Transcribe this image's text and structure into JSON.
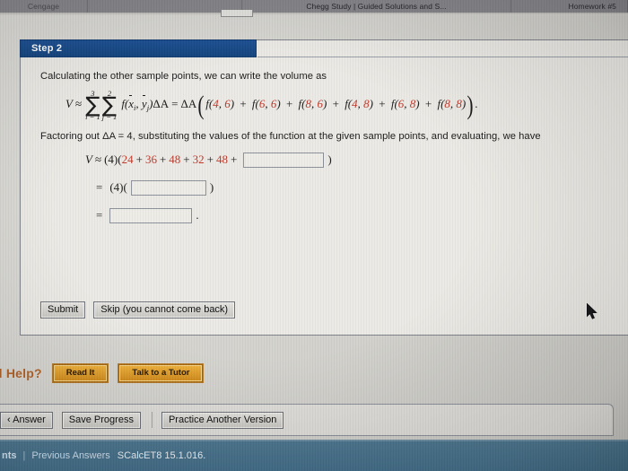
{
  "browser": {
    "tabs": [
      {
        "title": "Cengage"
      },
      {
        "title": ""
      },
      {
        "title": "Chegg Study | Guided Solutions and S..."
      },
      {
        "title": "Homework #5"
      }
    ]
  },
  "step": {
    "header_label": "Step 2",
    "intro_text": "Calculating the other sample points, we can write the volume as",
    "factoring_text": "Factoring out ΔA = 4, substituting the values of the function at the given sample points, and evaluating, we have"
  },
  "equation1": {
    "lhs_var": "V",
    "approx": "≈",
    "sum1": {
      "upper": "3",
      "lower": "i = 1"
    },
    "sum2": {
      "upper": "2",
      "lower": "j = 1"
    },
    "term": "f(x̅i, y̅j)ΔA",
    "equals": "=",
    "delta_a": "ΔA",
    "f_terms": [
      {
        "x": "4",
        "y": "6"
      },
      {
        "x": "6",
        "y": "6"
      },
      {
        "x": "8",
        "y": "6"
      },
      {
        "x": "4",
        "y": "8"
      },
      {
        "x": "6",
        "y": "8"
      },
      {
        "x": "8",
        "y": "8"
      }
    ],
    "trailing_period": "."
  },
  "equation2": {
    "lhs_var": "V",
    "approx": "≈",
    "factor": "(4)(",
    "values": [
      "24",
      "36",
      "48",
      "32",
      "48"
    ],
    "plus": "+",
    "input_value": "",
    "close_paren": ")"
  },
  "equation3": {
    "equals": "=",
    "factor": "(4)(",
    "input_value": "",
    "close_paren": ")"
  },
  "equation4": {
    "equals": "=",
    "input_value": "",
    "trailing_period": "."
  },
  "actions": {
    "submit_label": "Submit",
    "skip_label": "Skip (you cannot come back)"
  },
  "help": {
    "label": "d Help?",
    "read_it_label": "Read It",
    "tutor_label": "Talk to a Tutor"
  },
  "bottom_bar": {
    "answer_label": "‹ Answer",
    "save_label": "Save Progress",
    "practice_label": "Practice Another Version"
  },
  "footer": {
    "assignments_label": "nts",
    "separator": "|",
    "previous_answers_label": "Previous Answers",
    "exercise_id": "SCalcET8 15.1.016."
  },
  "colors": {
    "step_header_blue": "#14457f",
    "red_value": "#c0392b",
    "help_orange": "#cf8a1c",
    "footer_blue": "#44708b"
  },
  "icons": {
    "cursor": "mouse-pointer-icon"
  }
}
